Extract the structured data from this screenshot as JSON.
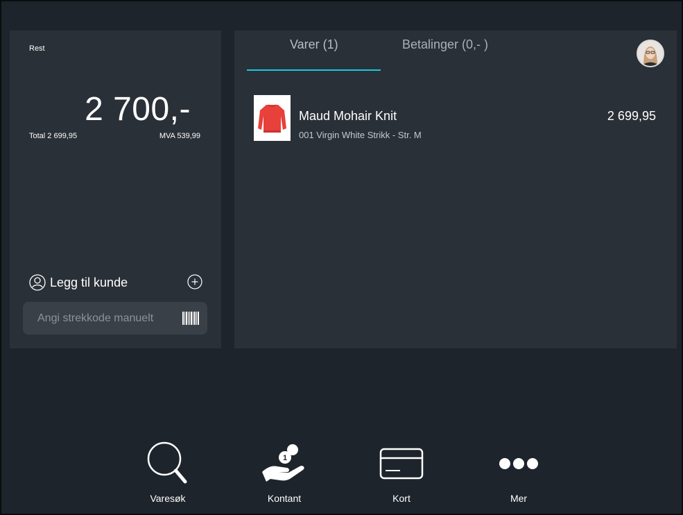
{
  "summary": {
    "rest_label": "Rest",
    "rest_amount": "2 700,-",
    "total": "Total 2 699,95",
    "mva": "MVA 539,99"
  },
  "customer": {
    "label": "Legg til kunde",
    "icon": "user-outline-icon",
    "add_icon": "plus-circle-icon"
  },
  "barcode": {
    "placeholder": "Angi strekkode manuelt",
    "value": "",
    "icon": "barcode-icon"
  },
  "tabs": [
    {
      "label": "Varer (1)",
      "active": true
    },
    {
      "label": "Betalinger (0,- )",
      "active": false
    }
  ],
  "items": [
    {
      "name": "Maud Mohair Knit",
      "variant": "001 Virgin White Strikk - Str. M",
      "price": "2 699,95"
    }
  ],
  "toolbar": [
    {
      "label": "Varesøk",
      "icon": "search-icon"
    },
    {
      "label": "Kontant",
      "icon": "cash-hand-icon"
    },
    {
      "label": "Kort",
      "icon": "credit-card-icon"
    },
    {
      "label": "Mer",
      "icon": "more-dots-icon"
    }
  ],
  "colors": {
    "background": "#1e242b",
    "panel": "#2a3037",
    "accent": "#1ac8de",
    "input": "#3a4047"
  }
}
